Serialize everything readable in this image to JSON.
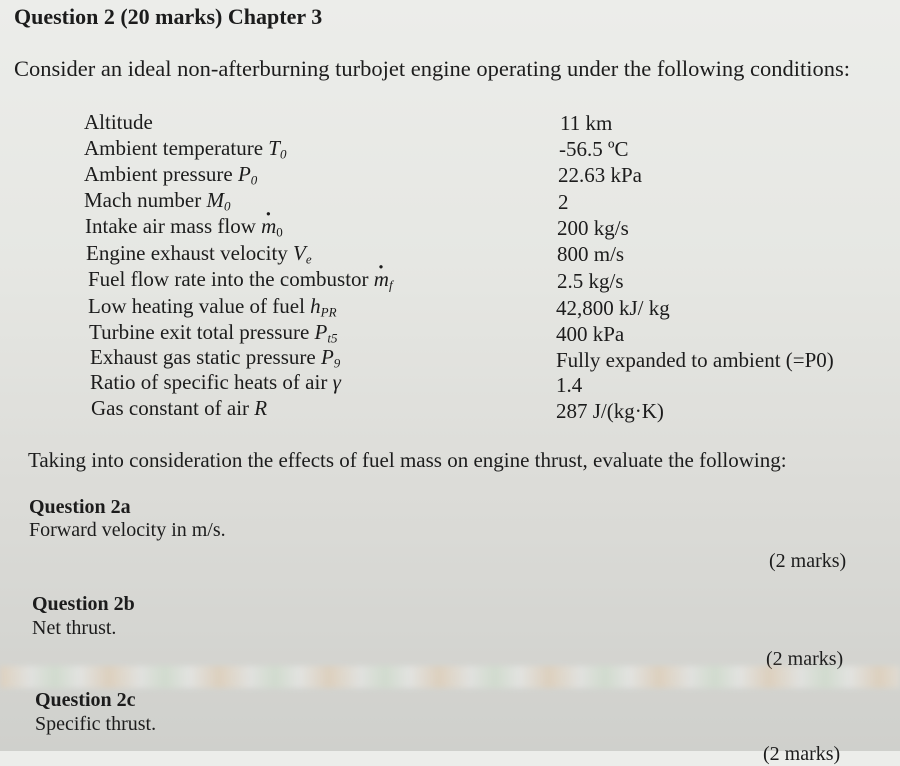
{
  "title": "Question 2 (20 marks) Chapter 3",
  "intro": "Consider an ideal non-afterburning turbojet engine operating under the following conditions:",
  "conditions": [
    {
      "label": "Altitude",
      "symbol": "",
      "sub": "",
      "value": "11 km"
    },
    {
      "label": "Ambient temperature ",
      "symbol": "T",
      "sub": "0",
      "value": "-56.5 ºC"
    },
    {
      "label": "Ambient pressure ",
      "symbol": "P",
      "sub": "0",
      "value": "22.63 kPa"
    },
    {
      "label": "Mach number ",
      "symbol": "M",
      "sub": "0",
      "value": "2"
    },
    {
      "label": "Intake air mass flow ",
      "symbol": "m",
      "sub": "0",
      "value": "200 kg/s"
    },
    {
      "label": "Engine exhaust velocity ",
      "symbol": "V",
      "sub": "e",
      "value": "800 m/s"
    },
    {
      "label": "Fuel flow rate into the combustor ",
      "symbol": "m",
      "sub": "f",
      "value": "2.5 kg/s"
    },
    {
      "label": "Low heating value of fuel ",
      "symbol": "h",
      "sub": "PR",
      "value": "42,800 kJ/ kg"
    },
    {
      "label": "Turbine exit total pressure ",
      "symbol": "P",
      "sub": "t5",
      "value": "400 kPa"
    },
    {
      "label": "Exhaust gas static pressure ",
      "symbol": "P",
      "sub": "9",
      "value": "Fully expanded to ambient (=P0)"
    },
    {
      "label": "Ratio of specific heats of air ",
      "symbol": "γ",
      "sub": "",
      "value": "1.4"
    },
    {
      "label": "Gas constant of air ",
      "symbol": "R",
      "sub": "",
      "value": "287 J/(kg·K)"
    }
  ],
  "instruction": "Taking into consideration the effects of fuel mass on engine thrust, evaluate the following:",
  "questions": [
    {
      "heading": "Question 2a",
      "text": "Forward velocity in m/s.",
      "marks": "(2 marks)"
    },
    {
      "heading": "Question 2b",
      "text": "Net thrust.",
      "marks": "(2 marks)"
    },
    {
      "heading": "Question 2c",
      "text": "Specific thrust.",
      "marks": "(2 marks)"
    }
  ]
}
